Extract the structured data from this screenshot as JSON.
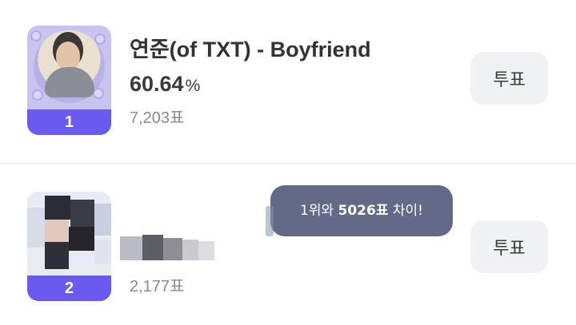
{
  "entries": [
    {
      "rank": "1",
      "title": "연준(of TXT) - Boyfriend",
      "percent_value": "60.64",
      "percent_unit": "%",
      "votes": "7,203표",
      "vote_label": "투표"
    },
    {
      "rank": "2",
      "votes": "2,177표",
      "vote_label": "투표"
    }
  ],
  "tooltip": {
    "prefix": "1위와 ",
    "diff": "5026표",
    "suffix": " 차이!"
  },
  "colors": {
    "rank_badge": "#6a5af0",
    "tooltip_bg": "#636a88",
    "button_bg": "#f0f1f5"
  }
}
